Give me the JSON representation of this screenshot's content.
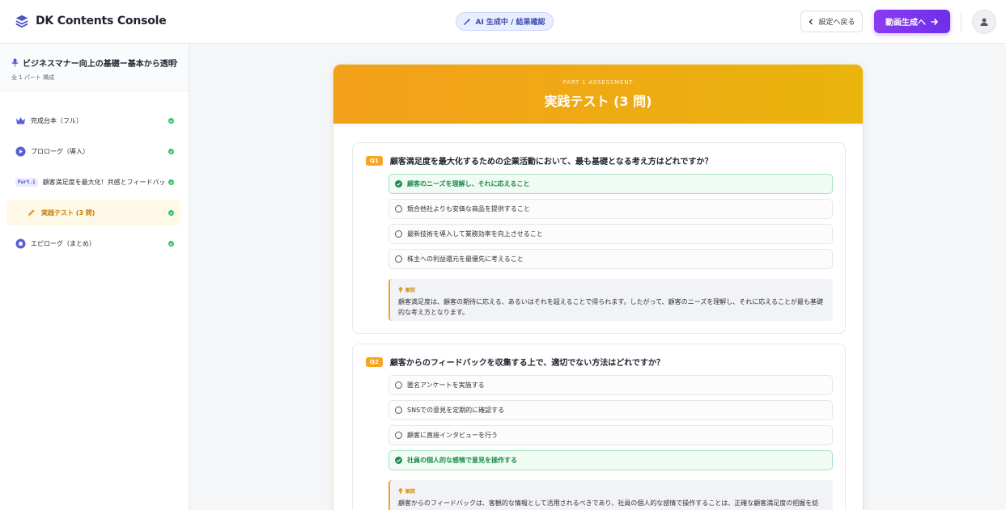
{
  "header": {
    "app_title": "DK Contents Console",
    "status": "AI 生成中 / 結果確認",
    "back_label": "設定へ戻る",
    "next_label": "動画生成へ",
    "icons": {
      "logo": "layers-icon",
      "status": "magic-wand-icon",
      "back": "chevron-left-icon",
      "next": "arrow-right-icon",
      "avatar": "user-icon"
    },
    "accent_color": "#7c35ee"
  },
  "sidebar": {
    "project_title": "ビジネスマナー向上の基礎ー基本から透明性と",
    "project_subtitle": "全 1 パート 構成",
    "items": [
      {
        "label": "完成台本（フル）",
        "icon": "crown-icon",
        "done": true
      },
      {
        "label": "プロローグ（導入）",
        "icon": "play-circle-icon",
        "done": true
      },
      {
        "badge": "Part.1",
        "label": "顧客満足度を最大化！共感とフィードバッ...",
        "done": true
      },
      {
        "label": "実践テスト (3 問)",
        "icon": "pencil-icon",
        "done": true,
        "active": true
      },
      {
        "label": "エピローグ（まとめ）",
        "icon": "stop-circle-icon",
        "done": true
      }
    ]
  },
  "assessment": {
    "kicker": "PART 1 ASSESSMENT",
    "title": "実践テスト (3 問)",
    "explain_label": "解説",
    "questions": [
      {
        "num": "Q1",
        "text": "顧客満足度を最大化するための企業活動において、最も基礎となる考え方はどれですか？",
        "options": [
          {
            "text": "顧客のニーズを理解し、それに応えること",
            "correct": true
          },
          {
            "text": "競合他社よりも安価な商品を提供すること",
            "correct": false
          },
          {
            "text": "最新技術を導入して業務効率を向上させること",
            "correct": false
          },
          {
            "text": "株主への利益還元を最優先に考えること",
            "correct": false
          }
        ],
        "explanation": "顧客満足度は、顧客の期待に応える、あるいはそれを超えることで得られます。したがって、顧客のニーズを理解し、それに応えることが最も基礎的な考え方となります。"
      },
      {
        "num": "Q2",
        "text": "顧客からのフィードバックを収集する上で、適切でない方法はどれですか？",
        "options": [
          {
            "text": "匿名アンケートを実施する",
            "correct": false
          },
          {
            "text": "SNSでの意見を定期的に確認する",
            "correct": false
          },
          {
            "text": "顧客に直接インタビューを行う",
            "correct": false
          },
          {
            "text": "社員の個人的な感情で意見を操作する",
            "correct": true
          }
        ],
        "explanation": "顧客からのフィードバックは、客観的な情報として活用されるべきであり、社員の個人的な感情で操作することは、正確な顧客満足度の把握を妨げます。"
      }
    ]
  }
}
